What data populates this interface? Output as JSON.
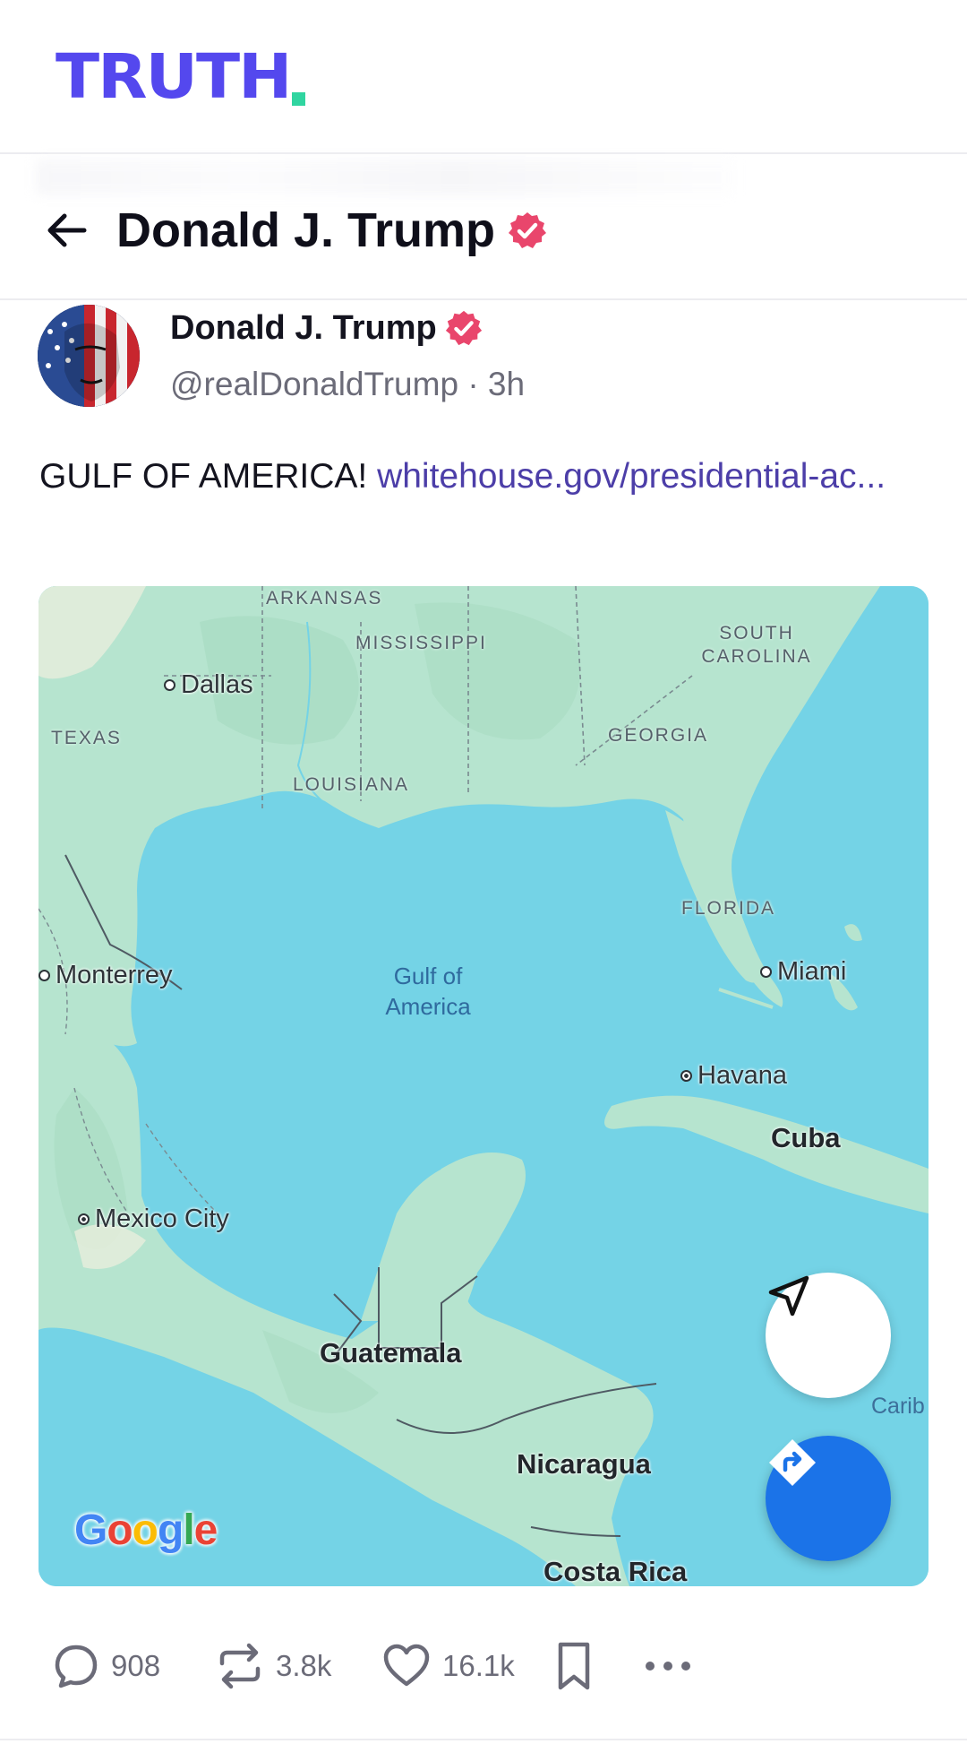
{
  "app": {
    "logo_text": "TRUTH",
    "brand_color": "#5448ee",
    "accent_color": "#30d5a0"
  },
  "nav": {
    "title": "Donald J. Trump",
    "back_icon": "arrow-left-icon",
    "verified_icon": "verified-badge-icon"
  },
  "post": {
    "author_name": "Donald J. Trump",
    "handle_time": "@realDonaldTrump · 3h",
    "text": "GULF OF AMERICA! ",
    "link_text": "whitehouse.gov/presidential-ac..."
  },
  "map": {
    "states": {
      "arkansas": "ARKANSAS",
      "mississippi": "MISSISSIPPI",
      "south_carolina": "SOUTH CAROLINA",
      "texas": "TEXAS",
      "georgia": "GEORGIA",
      "louisiana": "LOUISIANA",
      "florida": "FLORIDA"
    },
    "cities": {
      "dallas": "Dallas",
      "monterrey": "Monterrey",
      "miami": "Miami",
      "havana": "Havana",
      "mexico_city": "Mexico City"
    },
    "countries": {
      "cuba": "Cuba",
      "guatemala": "Guatemala",
      "nicaragua": "Nicaragua",
      "costa_rica": "Costa Rica"
    },
    "water_label": "Gulf of America",
    "carib_label": "Carib",
    "provider": "Google",
    "locate_icon": "navigation-arrow-icon",
    "directions_icon": "directions-icon",
    "water_color": "#74d3e6",
    "land_color": "#b6e4cf"
  },
  "actions": {
    "replies": "908",
    "retruths": "3.8k",
    "likes": "16.1k",
    "bookmark_icon": "bookmark-icon",
    "more_icon": "more-icon"
  }
}
